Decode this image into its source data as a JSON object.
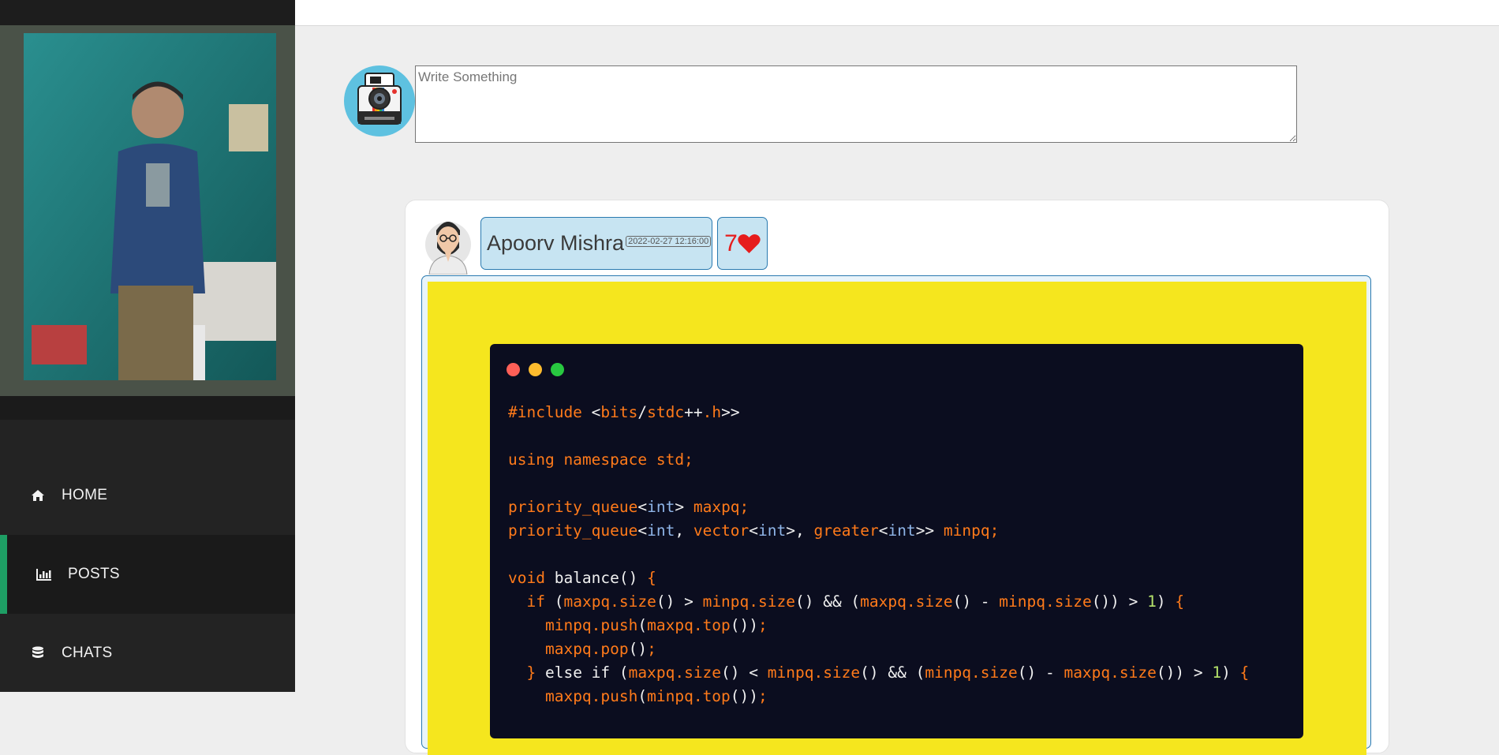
{
  "sidebar": {
    "nav": [
      {
        "label": "HOME",
        "icon": "home-icon",
        "active": false
      },
      {
        "label": "POSTS",
        "icon": "bar-chart-icon",
        "active": true
      },
      {
        "label": "CHATS",
        "icon": "database-icon",
        "active": false
      }
    ],
    "active_accent": "#1e9e64"
  },
  "composer": {
    "placeholder": "Write Something",
    "avatar_icon": "instant-camera-icon"
  },
  "post": {
    "author": "Apoorv Mishra",
    "timestamp": "2022-02-27 12:16:00",
    "likes": "7",
    "like_icon": "heart-icon",
    "image_bg": "#f5e61e",
    "code_lines": [
      [
        [
          "#include ",
          "o"
        ],
        [
          "<",
          "w"
        ],
        [
          "bits",
          "o"
        ],
        [
          "/",
          "w"
        ],
        [
          "stdc",
          "o"
        ],
        [
          "++",
          "w"
        ],
        [
          ".h",
          "o"
        ],
        [
          ">>",
          "w"
        ]
      ],
      [],
      [
        [
          "using namespace std;",
          "o"
        ]
      ],
      [],
      [
        [
          "priority_queue",
          "o"
        ],
        [
          "<",
          "w"
        ],
        [
          "int",
          "b"
        ],
        [
          "> ",
          "w"
        ],
        [
          "maxpq;",
          "o"
        ]
      ],
      [
        [
          "priority_queue",
          "o"
        ],
        [
          "<",
          "w"
        ],
        [
          "int",
          "b"
        ],
        [
          ", ",
          "w"
        ],
        [
          "vector",
          "o"
        ],
        [
          "<",
          "w"
        ],
        [
          "int",
          "b"
        ],
        [
          ">, ",
          "w"
        ],
        [
          "greater",
          "o"
        ],
        [
          "<",
          "w"
        ],
        [
          "int",
          "b"
        ],
        [
          ">> ",
          "w"
        ],
        [
          "minpq;",
          "o"
        ]
      ],
      [],
      [
        [
          "void ",
          "o"
        ],
        [
          "balance",
          "w"
        ],
        [
          "() ",
          "w"
        ],
        [
          "{",
          "o"
        ]
      ],
      [
        [
          "  ",
          "w"
        ],
        [
          "if ",
          "o"
        ],
        [
          "(",
          "w"
        ],
        [
          "maxpq.size",
          "o"
        ],
        [
          "() > ",
          "w"
        ],
        [
          "minpq.size",
          "o"
        ],
        [
          "() && (",
          "w"
        ],
        [
          "maxpq.size",
          "o"
        ],
        [
          "() - ",
          "w"
        ],
        [
          "minpq.size",
          "o"
        ],
        [
          "()) > ",
          "w"
        ],
        [
          "1",
          "g"
        ],
        [
          ") ",
          "w"
        ],
        [
          "{",
          "o"
        ]
      ],
      [
        [
          "    ",
          "w"
        ],
        [
          "minpq.push",
          "o"
        ],
        [
          "(",
          "w"
        ],
        [
          "maxpq.top",
          "o"
        ],
        [
          "())",
          "w"
        ],
        [
          ";",
          "o"
        ]
      ],
      [
        [
          "    ",
          "w"
        ],
        [
          "maxpq.pop",
          "o"
        ],
        [
          "()",
          "w"
        ],
        [
          ";",
          "o"
        ]
      ],
      [
        [
          "  ",
          "w"
        ],
        [
          "} ",
          "o"
        ],
        [
          "else if ",
          "w"
        ],
        [
          "(",
          "w"
        ],
        [
          "maxpq.size",
          "o"
        ],
        [
          "() < ",
          "w"
        ],
        [
          "minpq.size",
          "o"
        ],
        [
          "() && (",
          "w"
        ],
        [
          "minpq.size",
          "o"
        ],
        [
          "() - ",
          "w"
        ],
        [
          "maxpq.size",
          "o"
        ],
        [
          "()) > ",
          "w"
        ],
        [
          "1",
          "g"
        ],
        [
          ") ",
          "w"
        ],
        [
          "{",
          "o"
        ]
      ],
      [
        [
          "    ",
          "w"
        ],
        [
          "maxpq.push",
          "o"
        ],
        [
          "(",
          "w"
        ],
        [
          "minpq.top",
          "o"
        ],
        [
          "())",
          "w"
        ],
        [
          ";",
          "o"
        ]
      ]
    ]
  }
}
